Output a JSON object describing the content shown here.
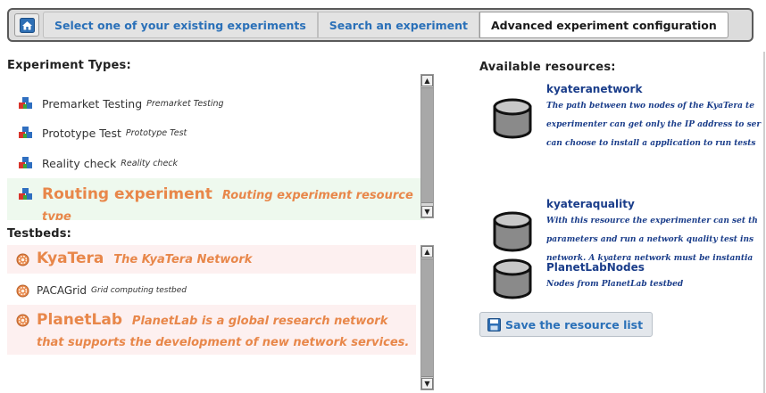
{
  "tabs": {
    "home_icon": "home-icon",
    "items": [
      {
        "label": "Select one of your existing experiments",
        "active": false
      },
      {
        "label": "Search an experiment",
        "active": false
      },
      {
        "label": "Advanced experiment configuration",
        "active": true
      }
    ]
  },
  "experiment_types": {
    "title": "Experiment Types:",
    "items": [
      {
        "name": "Premarket Testing",
        "description": "Premarket Testing",
        "icon": "blocks-icon"
      },
      {
        "name": "Prototype Test",
        "description": "Prototype Test",
        "icon": "blocks-icon"
      },
      {
        "name": "Reality check",
        "description": "Reality check",
        "icon": "blocks-icon"
      },
      {
        "name": "Routing experiment",
        "description": "Routing experiment resource type",
        "icon": "blocks-icon",
        "highlighted": true
      }
    ]
  },
  "testbeds": {
    "title": "Testbeds:",
    "items": [
      {
        "name": "KyaTera",
        "description": "The KyaTera Network",
        "icon": "gear-icon",
        "highlighted": true
      },
      {
        "name": "PACAGrid",
        "description": "Grid computing testbed",
        "icon": "gear-icon"
      },
      {
        "name": "PlanetLab",
        "description": "PlanetLab is a global research network that supports the development of new network services.",
        "icon": "gear-icon",
        "highlighted": true
      }
    ]
  },
  "resources": {
    "title": "Available resources:",
    "items": [
      {
        "name": "kyateranetwork",
        "lines": [
          "The path between two nodes of the KyaTera te",
          "experimenter can get only the IP address to ser",
          "can choose to install a application to run tests"
        ],
        "icon": "database-icon"
      },
      {
        "name": "kyateraquality",
        "lines": [
          "With this resource the experimenter can set th",
          "parameters and run a network quality test ins",
          "network. A kyatera network must be instantia"
        ],
        "icon": "database-icon"
      },
      {
        "name": "PlanetLabNodes",
        "lines": [
          "Nodes from PlanetLab testbed"
        ],
        "icon": "database-icon"
      }
    ],
    "save_label": "Save the resource list",
    "save_icon": "save-icon"
  },
  "colors": {
    "tab_link": "#2a70b8",
    "highlight_text": "#e8874a",
    "resource_text": "#1a3d8a",
    "experiment_highlight_bg": "#eef9ee",
    "testbed_highlight_bg": "#fdf0f0"
  }
}
